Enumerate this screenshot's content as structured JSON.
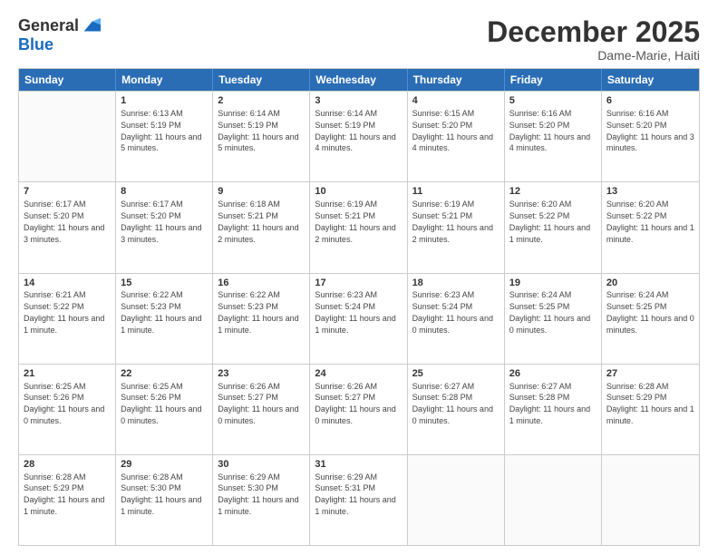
{
  "header": {
    "logo_line1": "General",
    "logo_line2": "Blue",
    "month": "December 2025",
    "location": "Dame-Marie, Haiti"
  },
  "weekdays": [
    "Sunday",
    "Monday",
    "Tuesday",
    "Wednesday",
    "Thursday",
    "Friday",
    "Saturday"
  ],
  "rows": [
    [
      {
        "day": "",
        "sunrise": "",
        "sunset": "",
        "daylight": ""
      },
      {
        "day": "1",
        "sunrise": "6:13 AM",
        "sunset": "5:19 PM",
        "daylight": "11 hours and 5 minutes."
      },
      {
        "day": "2",
        "sunrise": "6:14 AM",
        "sunset": "5:19 PM",
        "daylight": "11 hours and 5 minutes."
      },
      {
        "day": "3",
        "sunrise": "6:14 AM",
        "sunset": "5:19 PM",
        "daylight": "11 hours and 4 minutes."
      },
      {
        "day": "4",
        "sunrise": "6:15 AM",
        "sunset": "5:20 PM",
        "daylight": "11 hours and 4 minutes."
      },
      {
        "day": "5",
        "sunrise": "6:16 AM",
        "sunset": "5:20 PM",
        "daylight": "11 hours and 4 minutes."
      },
      {
        "day": "6",
        "sunrise": "6:16 AM",
        "sunset": "5:20 PM",
        "daylight": "11 hours and 3 minutes."
      }
    ],
    [
      {
        "day": "7",
        "sunrise": "6:17 AM",
        "sunset": "5:20 PM",
        "daylight": "11 hours and 3 minutes."
      },
      {
        "day": "8",
        "sunrise": "6:17 AM",
        "sunset": "5:20 PM",
        "daylight": "11 hours and 3 minutes."
      },
      {
        "day": "9",
        "sunrise": "6:18 AM",
        "sunset": "5:21 PM",
        "daylight": "11 hours and 2 minutes."
      },
      {
        "day": "10",
        "sunrise": "6:19 AM",
        "sunset": "5:21 PM",
        "daylight": "11 hours and 2 minutes."
      },
      {
        "day": "11",
        "sunrise": "6:19 AM",
        "sunset": "5:21 PM",
        "daylight": "11 hours and 2 minutes."
      },
      {
        "day": "12",
        "sunrise": "6:20 AM",
        "sunset": "5:22 PM",
        "daylight": "11 hours and 1 minute."
      },
      {
        "day": "13",
        "sunrise": "6:20 AM",
        "sunset": "5:22 PM",
        "daylight": "11 hours and 1 minute."
      }
    ],
    [
      {
        "day": "14",
        "sunrise": "6:21 AM",
        "sunset": "5:22 PM",
        "daylight": "11 hours and 1 minute."
      },
      {
        "day": "15",
        "sunrise": "6:22 AM",
        "sunset": "5:23 PM",
        "daylight": "11 hours and 1 minute."
      },
      {
        "day": "16",
        "sunrise": "6:22 AM",
        "sunset": "5:23 PM",
        "daylight": "11 hours and 1 minute."
      },
      {
        "day": "17",
        "sunrise": "6:23 AM",
        "sunset": "5:24 PM",
        "daylight": "11 hours and 1 minute."
      },
      {
        "day": "18",
        "sunrise": "6:23 AM",
        "sunset": "5:24 PM",
        "daylight": "11 hours and 0 minutes."
      },
      {
        "day": "19",
        "sunrise": "6:24 AM",
        "sunset": "5:25 PM",
        "daylight": "11 hours and 0 minutes."
      },
      {
        "day": "20",
        "sunrise": "6:24 AM",
        "sunset": "5:25 PM",
        "daylight": "11 hours and 0 minutes."
      }
    ],
    [
      {
        "day": "21",
        "sunrise": "6:25 AM",
        "sunset": "5:26 PM",
        "daylight": "11 hours and 0 minutes."
      },
      {
        "day": "22",
        "sunrise": "6:25 AM",
        "sunset": "5:26 PM",
        "daylight": "11 hours and 0 minutes."
      },
      {
        "day": "23",
        "sunrise": "6:26 AM",
        "sunset": "5:27 PM",
        "daylight": "11 hours and 0 minutes."
      },
      {
        "day": "24",
        "sunrise": "6:26 AM",
        "sunset": "5:27 PM",
        "daylight": "11 hours and 0 minutes."
      },
      {
        "day": "25",
        "sunrise": "6:27 AM",
        "sunset": "5:28 PM",
        "daylight": "11 hours and 0 minutes."
      },
      {
        "day": "26",
        "sunrise": "6:27 AM",
        "sunset": "5:28 PM",
        "daylight": "11 hours and 1 minute."
      },
      {
        "day": "27",
        "sunrise": "6:28 AM",
        "sunset": "5:29 PM",
        "daylight": "11 hours and 1 minute."
      }
    ],
    [
      {
        "day": "28",
        "sunrise": "6:28 AM",
        "sunset": "5:29 PM",
        "daylight": "11 hours and 1 minute."
      },
      {
        "day": "29",
        "sunrise": "6:28 AM",
        "sunset": "5:30 PM",
        "daylight": "11 hours and 1 minute."
      },
      {
        "day": "30",
        "sunrise": "6:29 AM",
        "sunset": "5:30 PM",
        "daylight": "11 hours and 1 minute."
      },
      {
        "day": "31",
        "sunrise": "6:29 AM",
        "sunset": "5:31 PM",
        "daylight": "11 hours and 1 minute."
      },
      {
        "day": "",
        "sunrise": "",
        "sunset": "",
        "daylight": ""
      },
      {
        "day": "",
        "sunrise": "",
        "sunset": "",
        "daylight": ""
      },
      {
        "day": "",
        "sunrise": "",
        "sunset": "",
        "daylight": ""
      }
    ]
  ]
}
